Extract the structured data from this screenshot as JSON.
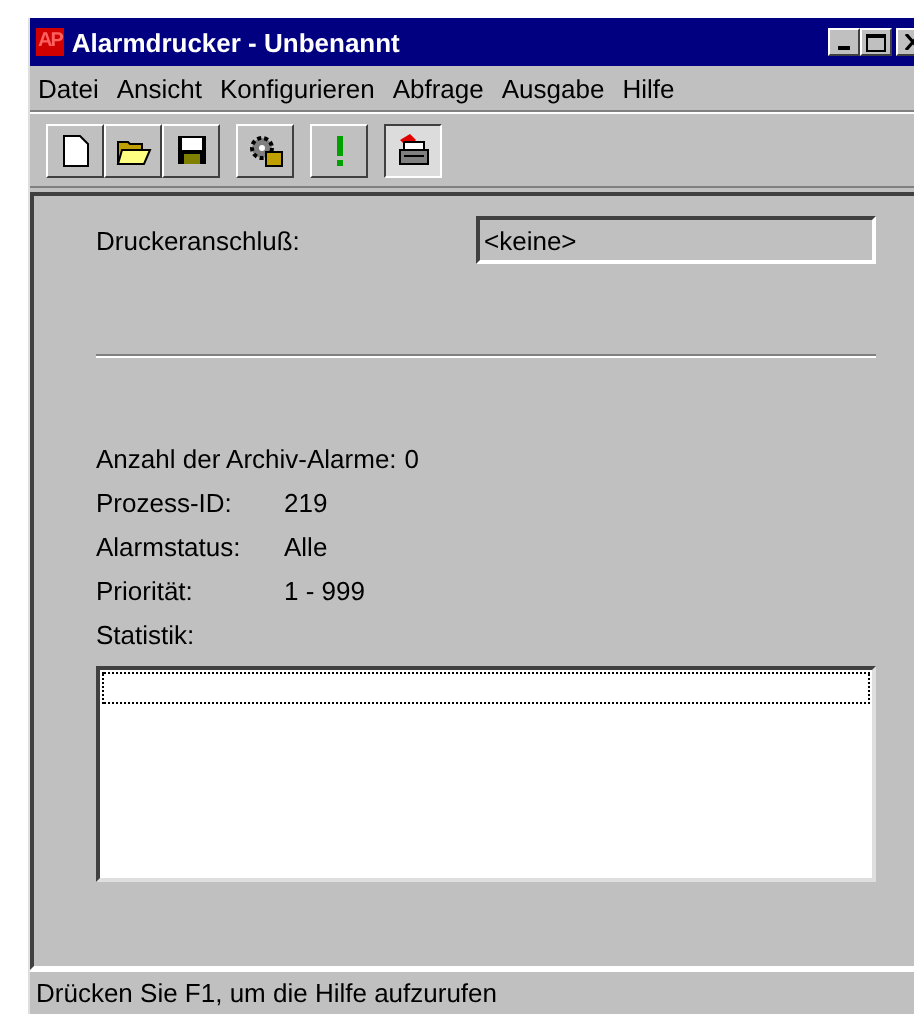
{
  "window": {
    "title": "Alarmdrucker - Unbenannt",
    "app_icon": "AP"
  },
  "menu": [
    {
      "label": "Datei"
    },
    {
      "label": "Ansicht"
    },
    {
      "label": "Konfigurieren"
    },
    {
      "label": "Abfrage"
    },
    {
      "label": "Ausgabe"
    },
    {
      "label": "Hilfe"
    }
  ],
  "toolbar": [
    {
      "buttons": [
        {
          "kind": "new",
          "selected": false
        },
        {
          "kind": "open",
          "selected": false
        },
        {
          "kind": "save",
          "selected": false
        }
      ]
    },
    {
      "buttons": [
        {
          "kind": "gear",
          "selected": false
        }
      ]
    },
    {
      "buttons": [
        {
          "kind": "alert",
          "selected": false
        }
      ]
    },
    {
      "buttons": [
        {
          "kind": "printer",
          "selected": true
        }
      ]
    }
  ],
  "printer_port": {
    "label": "Druckeranschluß:",
    "value": "<keine>"
  },
  "info": [
    {
      "label": "Anzahl der Archiv-Alarme:",
      "value": "0"
    },
    {
      "label": "Prozess-ID:",
      "value": "219"
    },
    {
      "label": "Alarmstatus:",
      "value": "Alle"
    },
    {
      "label": "Priorität:",
      "value": "1 - 999"
    }
  ],
  "statistics": {
    "label": "Statistik:",
    "rows": [
      {
        "text": "",
        "focused": true
      }
    ]
  },
  "status_bar": "Drücken Sie F1, um die Hilfe aufzurufen"
}
